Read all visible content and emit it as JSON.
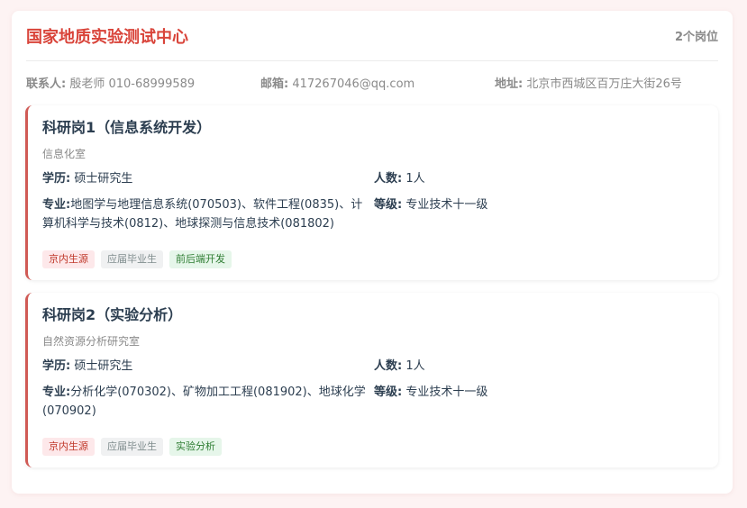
{
  "org": {
    "title": "国家地质实验测试中心",
    "position_count": "2个岗位"
  },
  "contact": {
    "person_label": "联系人:",
    "person_value": "殷老师 010-68999589",
    "email_label": "邮箱:",
    "email_value": "417267046@qq.com",
    "address_label": "地址:",
    "address_value": "北京市西城区百万庄大街26号"
  },
  "jobs": [
    {
      "title": "科研岗1（信息系统开发）",
      "department": "信息化室",
      "education_label": "学历:",
      "education_value": "硕士研究生",
      "headcount_label": "人数:",
      "headcount_value": "1人",
      "major_label": "专业:",
      "major_value": "地图学与地理信息系统(070503)、软件工程(0835)、计算机科学与技术(0812)、地球探测与信息技术(081802)",
      "grade_label": "等级:",
      "grade_value": "专业技术十一级",
      "tags": [
        "京内生源",
        "应届毕业生",
        "前后端开发"
      ]
    },
    {
      "title": "科研岗2（实验分析）",
      "department": "自然资源分析研究室",
      "education_label": "学历:",
      "education_value": "硕士研究生",
      "headcount_label": "人数:",
      "headcount_value": "1人",
      "major_label": "专业:",
      "major_value": "分析化学(070302)、矿物加工工程(081902)、地球化学(070902)",
      "grade_label": "等级:",
      "grade_value": "专业技术十一级",
      "tags": [
        "京内生源",
        "应届毕业生",
        "实验分析"
      ]
    }
  ],
  "colors": {
    "accent": "#d9443a",
    "job_border": "#d05a55",
    "tag_red_bg": "#fde8ea",
    "tag_gray_bg": "#f0f1f2",
    "tag_green_bg": "#e6f6ea"
  }
}
